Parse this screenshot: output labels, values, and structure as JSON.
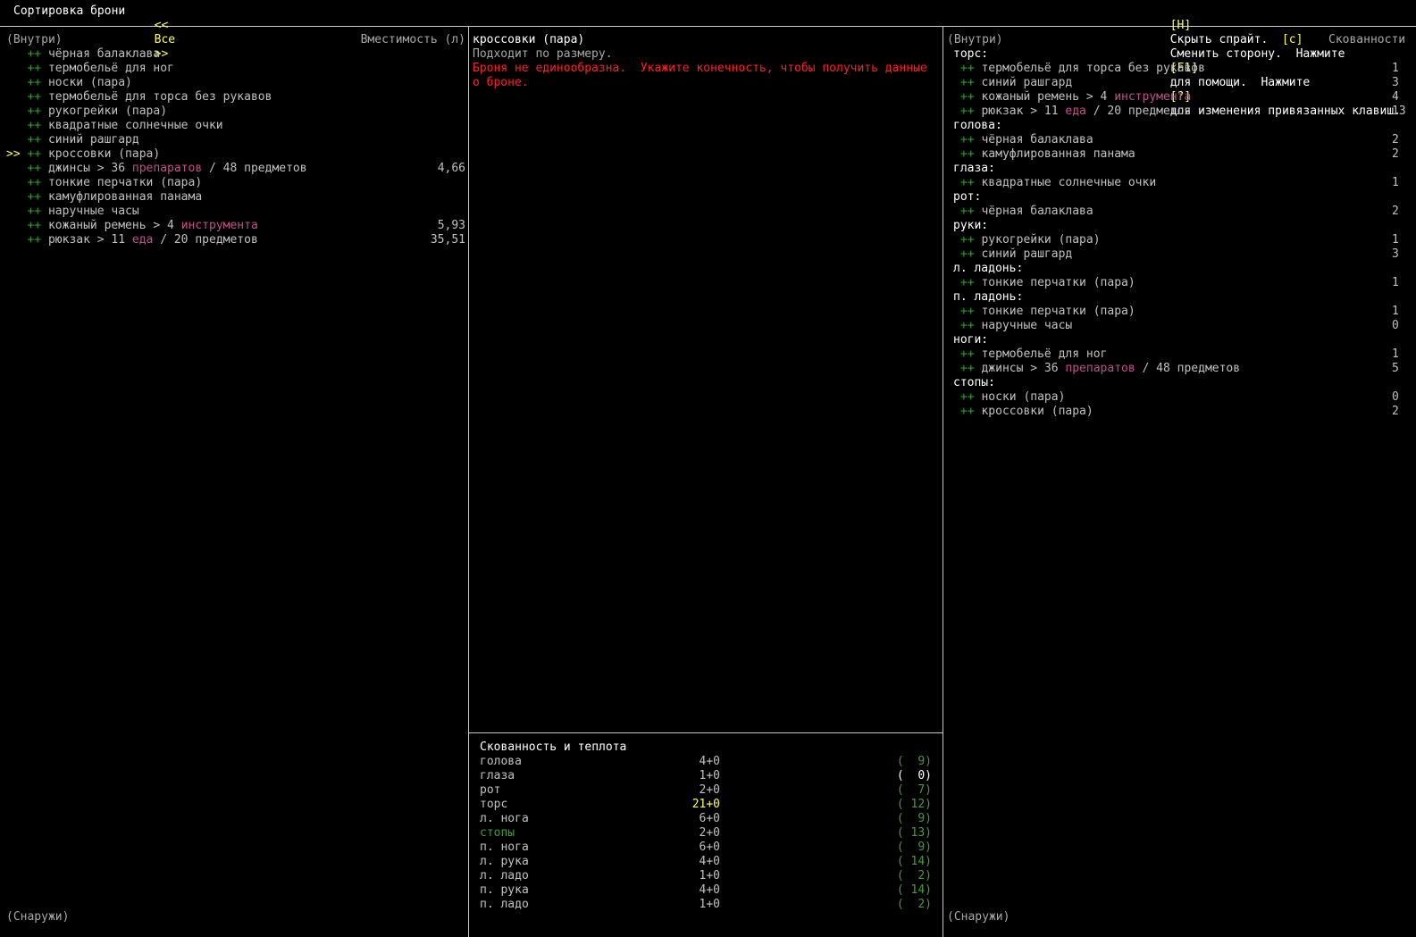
{
  "header": {
    "title": "Сортировка брони",
    "filter_prev": "<<",
    "filter_value": "Все",
    "filter_next": ">>",
    "hide_key": "[H]",
    "hide_label": "Скрыть спрайт.",
    "side_key": "[c]",
    "side_label": "Сменить сторону.",
    "help_prefix": "Нажмите",
    "help_key": "[F1]",
    "help_label": "для помощи.",
    "keys_prefix": "Нажмите",
    "keys_key": "[?]",
    "keys_label": "для изменения привязанных клавиш."
  },
  "left": {
    "inside_label": "(Внутри)",
    "capacity_label": "Вместимость (л)",
    "outside_label": "(Снаружи)",
    "cursor": ">>",
    "bullet": "++",
    "items": [
      {
        "name": "чёрная балаклава"
      },
      {
        "name": "термобельё для ног"
      },
      {
        "name": "носки (пара)"
      },
      {
        "name": "термобельё для торса без рукавов"
      },
      {
        "name": "рукогрейки (пара)"
      },
      {
        "name": "квадратные солнечные очки"
      },
      {
        "name": "синий рашгард"
      },
      {
        "name": "кроссовки (пара)",
        "selected": true
      },
      {
        "name": "джинсы > 36",
        "hl": "препаратов",
        "tail": "/ 48 предметов",
        "value": "4,66"
      },
      {
        "name": "тонкие перчатки (пара)"
      },
      {
        "name": "камуфлированная панама"
      },
      {
        "name": "наручные часы"
      },
      {
        "name": "кожаный ремень > 4",
        "hl": "инструмента",
        "tail": "",
        "value": "5,93"
      },
      {
        "name": "рюкзак > 11",
        "hl": "еда",
        "tail": "/ 20 предметов",
        "value": "35,51"
      }
    ]
  },
  "middle": {
    "item_title": "кроссовки (пара)",
    "fit_text": "Подходит по размеру.",
    "warning_line1": "Броня не единообразна.  Укажите конечность, чтобы получить данные",
    "warning_line2": "о броне.",
    "stats_title": "Скованность и теплота",
    "stats": [
      {
        "part": "голова",
        "enc": "4+0",
        "warm": "(  9)"
      },
      {
        "part": "глаза",
        "enc": "1+0",
        "warm": "(  0)"
      },
      {
        "part": "рот",
        "enc": "2+0",
        "warm": "(  7)"
      },
      {
        "part": "торс",
        "enc": "21+0",
        "warm": "( 12)"
      },
      {
        "part": "л. нога",
        "enc": "6+0",
        "warm": "(  9)"
      },
      {
        "part": "стопы",
        "enc": "2+0",
        "warm": "( 13)"
      },
      {
        "part": "п. нога",
        "enc": "6+0",
        "warm": "(  9)"
      },
      {
        "part": "л. рука",
        "enc": "4+0",
        "warm": "( 14)"
      },
      {
        "part": "л. ладо",
        "enc": "1+0",
        "warm": "(  2)"
      },
      {
        "part": "п. рука",
        "enc": "4+0",
        "warm": "( 14)"
      },
      {
        "part": "п. ладо",
        "enc": "1+0",
        "warm": "(  2)"
      }
    ]
  },
  "right": {
    "inside_label": "(Внутри)",
    "enc_label": "Скованности",
    "outside_label": "(Снаружи)",
    "groups": [
      {
        "label": "торс:",
        "items": [
          {
            "name": "термобельё для торса без рукавов",
            "value": "1"
          },
          {
            "name": "синий рашгард",
            "value": "3"
          },
          {
            "name": "кожаный ремень > 4",
            "hl": "инструмента",
            "tail": "",
            "value": "4"
          },
          {
            "name": "рюкзак > 11",
            "hl": "еда",
            "tail": "/ 20 предметов",
            "value": "13"
          }
        ]
      },
      {
        "label": "голова:",
        "items": [
          {
            "name": "чёрная балаклава",
            "value": "2"
          },
          {
            "name": "камуфлированная панама",
            "value": "2"
          }
        ]
      },
      {
        "label": "глаза:",
        "items": [
          {
            "name": "квадратные солнечные очки",
            "value": "1"
          }
        ]
      },
      {
        "label": "рот:",
        "items": [
          {
            "name": "чёрная балаклава",
            "value": "2"
          }
        ]
      },
      {
        "label": "руки:",
        "items": [
          {
            "name": "рукогрейки (пара)",
            "value": "1"
          },
          {
            "name": "синий рашгард",
            "value": "3"
          }
        ]
      },
      {
        "label": "л. ладонь:",
        "items": [
          {
            "name": "тонкие перчатки (пара)",
            "value": "1"
          }
        ]
      },
      {
        "label": "п. ладонь:",
        "items": [
          {
            "name": "тонкие перчатки (пара)",
            "value": "1"
          },
          {
            "name": "наручные часы",
            "value": "0"
          }
        ]
      },
      {
        "label": "ноги:",
        "items": [
          {
            "name": "термобельё для ног",
            "value": "1"
          },
          {
            "name": "джинсы > 36",
            "hl": "препаратов",
            "tail": "/ 48 предметов",
            "value": "5"
          }
        ]
      },
      {
        "label": "стопы:",
        "items": [
          {
            "name": "носки (пара)",
            "value": "0"
          },
          {
            "name": "кроссовки (пара)",
            "value": "2"
          }
        ]
      }
    ]
  }
}
